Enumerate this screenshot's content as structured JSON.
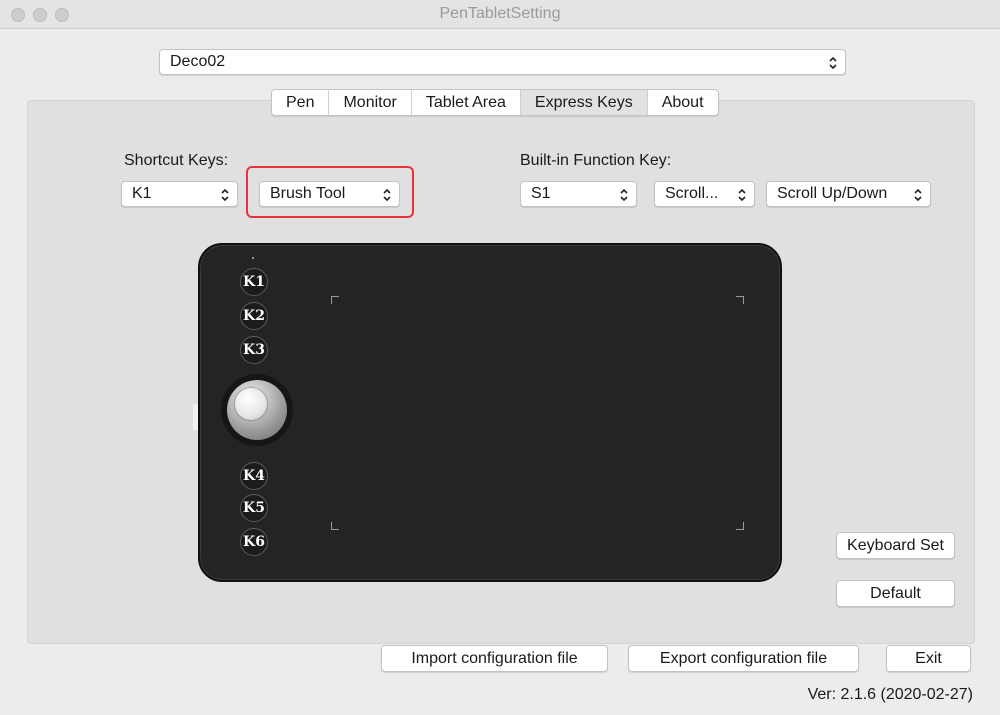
{
  "window": {
    "title": "PenTabletSetting"
  },
  "device_select": {
    "value": "Deco02"
  },
  "tabs": [
    {
      "label": "Pen",
      "active": false
    },
    {
      "label": "Monitor",
      "active": false
    },
    {
      "label": "Tablet Area",
      "active": false
    },
    {
      "label": "Express Keys",
      "active": true
    },
    {
      "label": "About",
      "active": false
    }
  ],
  "shortcut": {
    "label": "Shortcut Keys:",
    "key_value": "K1",
    "action_value": "Brush Tool"
  },
  "builtin": {
    "label": "Built-in Function Key:",
    "key_value": "S1",
    "mode_value": "Scroll...",
    "function_value": "Scroll Up/Down"
  },
  "tablet": {
    "keys_top": [
      "K1",
      "K2",
      "K3"
    ],
    "keys_bottom": [
      "K4",
      "K5",
      "K6"
    ]
  },
  "buttons": {
    "keyboard_set": "Keyboard Set",
    "default": "Default",
    "import": "Import configuration file",
    "export": "Export configuration file",
    "exit": "Exit"
  },
  "version": "Ver: 2.1.6 (2020-02-27)",
  "colors": {
    "highlight": "#e8323c",
    "tablet_body": "#242424",
    "window_bg": "#ececec"
  }
}
